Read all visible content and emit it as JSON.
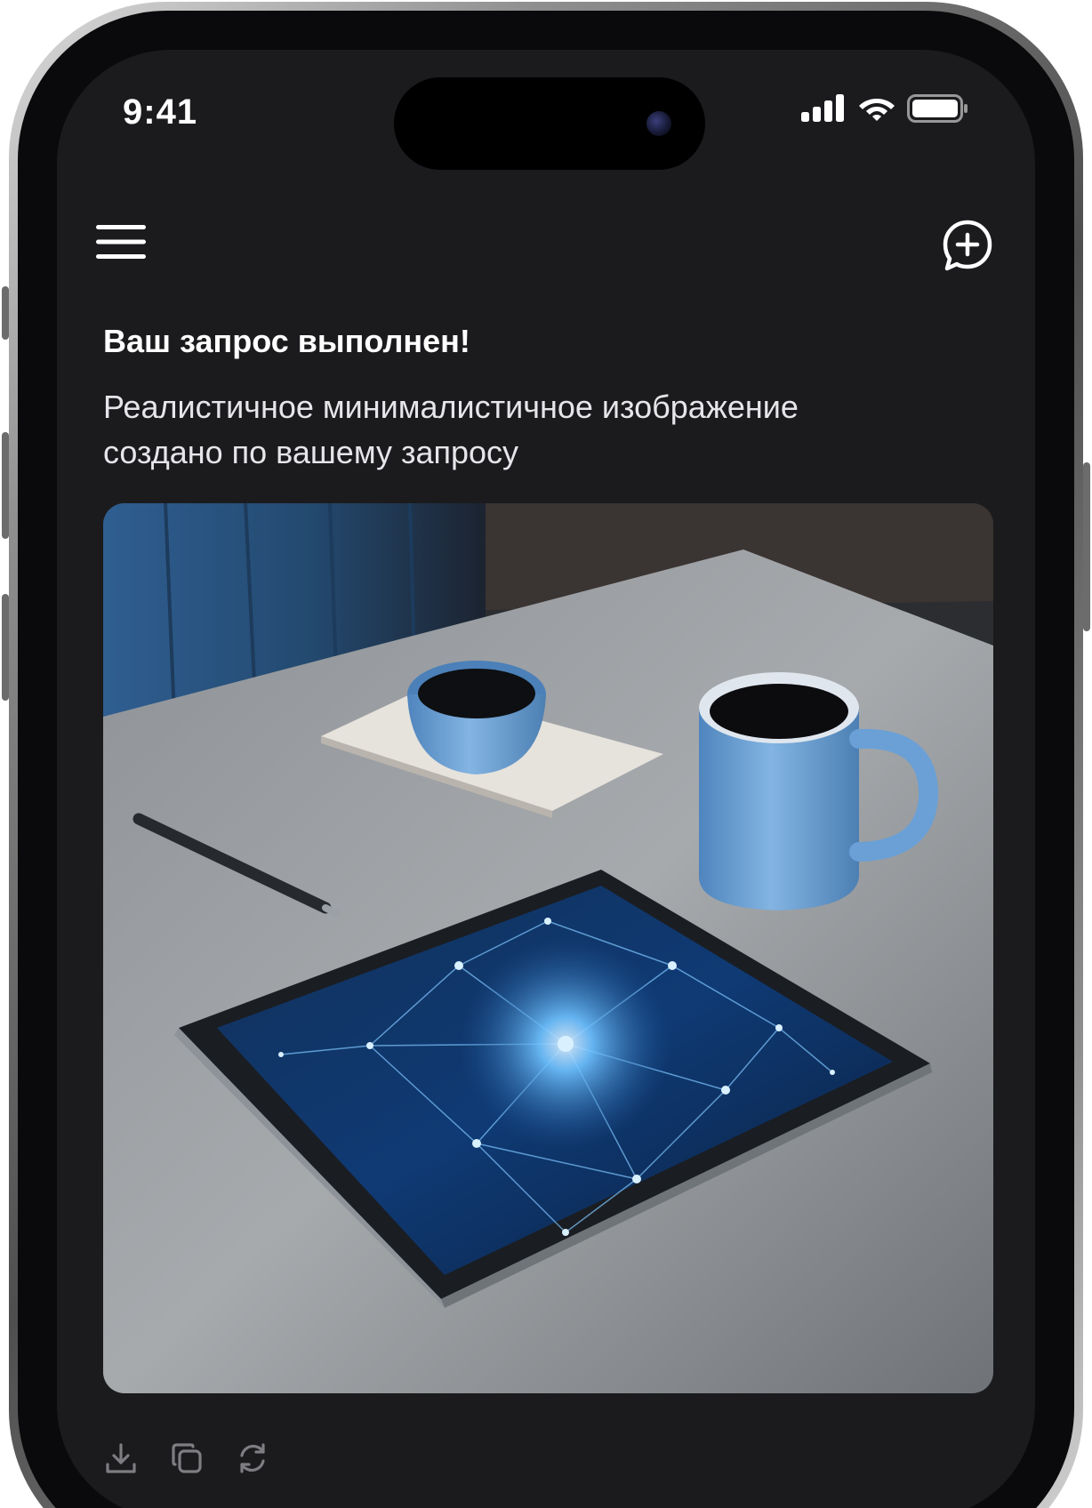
{
  "status_bar": {
    "time": "9:41",
    "icons": [
      "cellular-signal-icon",
      "wifi-icon",
      "battery-icon"
    ]
  },
  "header": {
    "menu_icon": "hamburger-menu-icon",
    "new_chat_icon": "chat-bubble-plus-icon"
  },
  "message": {
    "title": "Ваш запрос выполнен!",
    "body": "Реалистичное минималистичное изображение создано по вашему запросу"
  },
  "generated_image": {
    "subject": "generated-image"
  },
  "actions": [
    {
      "icon": "download-icon"
    },
    {
      "icon": "copy-icon"
    },
    {
      "icon": "regenerate-icon"
    }
  ],
  "colors": {
    "screen_background": "#1b1b1e",
    "text_primary": "#ffffff",
    "text_secondary": "#e6e6ea",
    "icon_muted": "#7d7d82",
    "accent_blue": "#5f95cc"
  }
}
